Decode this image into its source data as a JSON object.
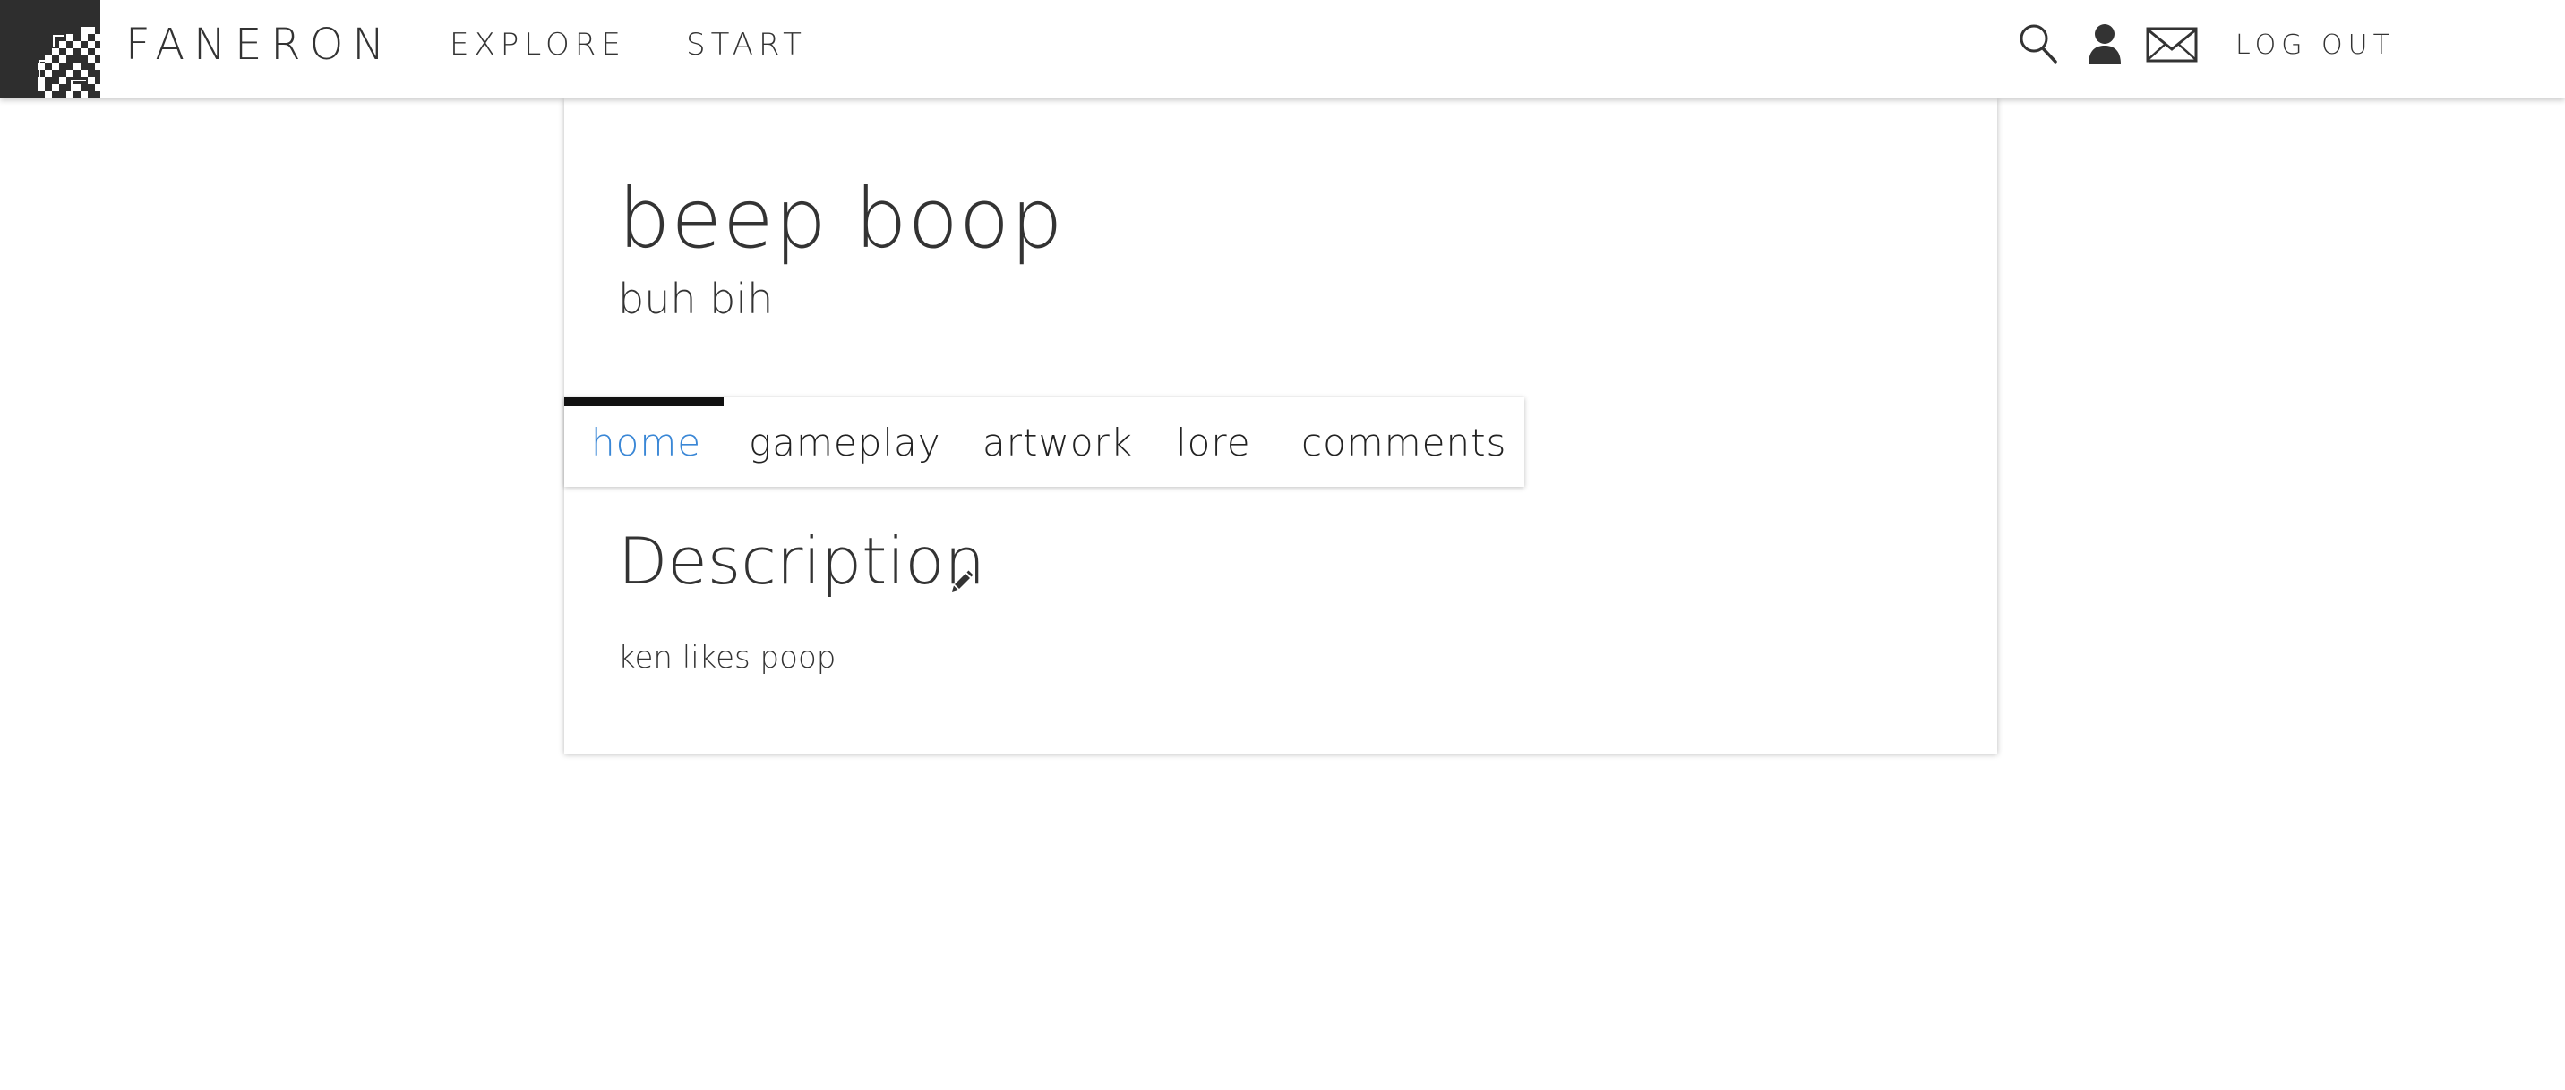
{
  "header": {
    "brand": "FANERON",
    "nav": [
      {
        "label": "EXPLORE"
      },
      {
        "label": "START"
      }
    ],
    "icons": [
      "search-icon",
      "user-icon",
      "mail-icon"
    ],
    "logout_label": "LOG OUT"
  },
  "project": {
    "title": "beep boop",
    "subtitle": "buh bih"
  },
  "tabs": [
    {
      "label": "home",
      "active": true
    },
    {
      "label": "gameplay",
      "active": false
    },
    {
      "label": "artwork",
      "active": false
    },
    {
      "label": "lore",
      "active": false
    },
    {
      "label": "comments",
      "active": false
    }
  ],
  "description": {
    "heading": "Description",
    "body": "ken likes poop"
  },
  "colors": {
    "accent": "#3a87d6",
    "logo_bg": "#2e2e2e",
    "text": "#333333",
    "active_tab_indicator": "#111111"
  }
}
